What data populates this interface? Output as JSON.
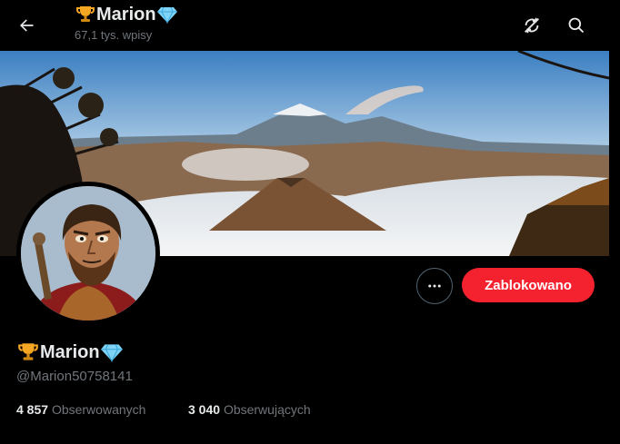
{
  "header": {
    "name": "Marion",
    "posts_count": "67,1 tys. wpisy"
  },
  "profile": {
    "display_name": "Marion",
    "handle": "@Marion50758141",
    "following_count": "4 857",
    "following_label": "Obserwowanych",
    "followers_count": "3 040",
    "followers_label": "Obserwujących",
    "status_button": "Zablokowano"
  },
  "icons": {
    "back": "arrow-left-icon",
    "refresh": "refresh-off-icon",
    "search": "search-icon",
    "more": "more-dots-icon",
    "trophy": "trophy-emoji-icon",
    "diamond": "diamond-emoji-icon"
  },
  "colors": {
    "accent_red": "#f4212e",
    "secondary_text": "#71767b",
    "primary_text": "#e7e9ea"
  }
}
